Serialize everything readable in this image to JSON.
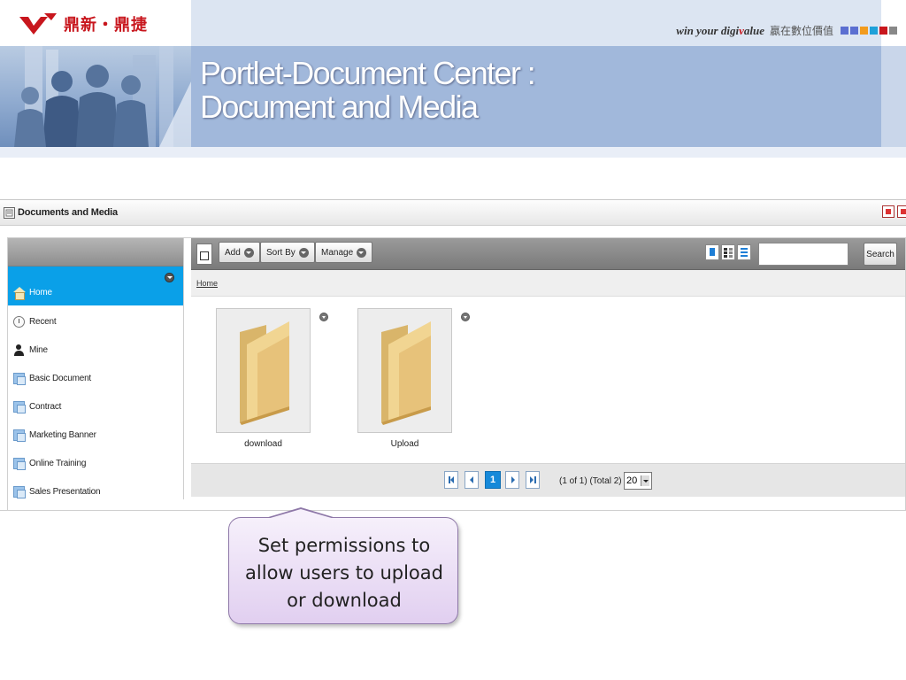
{
  "slide": {
    "brand": "鼎新‧鼎捷",
    "tagline_prefix": "win your digi",
    "tagline_v": "v",
    "tagline_suffix": "alue",
    "tagline_zh": "贏在數位價值",
    "title_line1": "Portlet-Document Center :",
    "title_line2": "Document  and Media",
    "colors": {
      "brand_red": "#c8161d",
      "title_band": "#a1b8db",
      "squares": [
        "#5b6fd1",
        "#5b6fd1",
        "#f29b1d",
        "#1fa1d9",
        "#c8161d",
        "#888888"
      ]
    }
  },
  "portlet": {
    "title": "Documents and Media",
    "title_icon": "portlet-icon",
    "window_controls": [
      "minimize-icon",
      "maximize-icon"
    ]
  },
  "sidebar": {
    "items": [
      {
        "label": "Home",
        "icon": "home-icon",
        "active": true
      },
      {
        "label": "Recent",
        "icon": "clock-icon"
      },
      {
        "label": "Mine",
        "icon": "user-icon"
      },
      {
        "label": "Basic Document",
        "icon": "folder-icon"
      },
      {
        "label": "Contract",
        "icon": "folder-icon"
      },
      {
        "label": "Marketing Banner",
        "icon": "folder-icon"
      },
      {
        "label": "Online Training",
        "icon": "folder-icon"
      },
      {
        "label": "Sales Presentation",
        "icon": "folder-icon"
      }
    ]
  },
  "toolbar": {
    "add": "Add",
    "sort_by": "Sort By",
    "manage": "Manage",
    "search_placeholder": "",
    "search_button": "Search",
    "view_modes": [
      "icon-view",
      "descriptive-view",
      "list-view"
    ],
    "active_view": "icon-view"
  },
  "breadcrumb": {
    "home": "Home"
  },
  "files": [
    {
      "name": "download",
      "icon": "folder-icon"
    },
    {
      "name": "Upload",
      "icon": "folder-icon"
    }
  ],
  "pagination": {
    "current_page": "1",
    "info": "(1 of 1) (Total 2)",
    "page_size": "20"
  },
  "callout": {
    "line1": "Set permissions to",
    "line2": "allow users to upload",
    "line3": "or download"
  }
}
